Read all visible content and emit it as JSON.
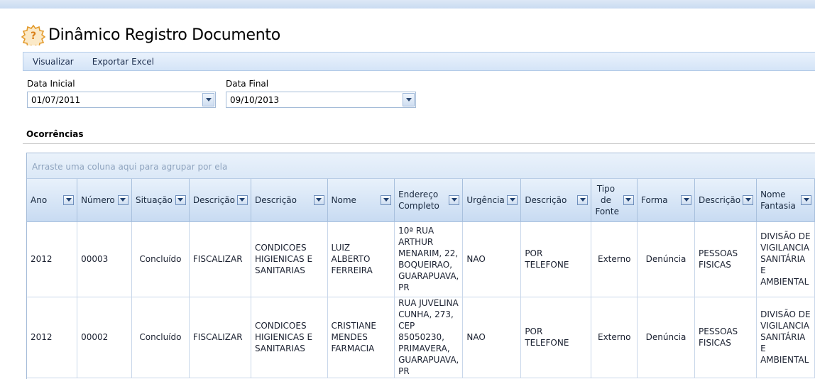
{
  "page": {
    "title": "Dinâmico Registro Documento"
  },
  "toolbar": {
    "items": [
      "Visualizar",
      "Exportar Excel"
    ]
  },
  "filters": {
    "start": {
      "label": "Data Inicial",
      "value": "01/07/2011"
    },
    "end": {
      "label": "Data Final",
      "value": "09/10/2013"
    }
  },
  "section": {
    "title": "Ocorrências"
  },
  "grid": {
    "group_hint": "Arraste uma coluna aqui para agrupar por ela",
    "columns": [
      "Ano",
      "Número",
      "Situação",
      "Descrição",
      "Descrição",
      "Nome",
      "Endereço Completo",
      "Urgência",
      "Descrição",
      "Tipo de Fonte",
      "Forma",
      "Descrição",
      "Nome Fantasia"
    ],
    "rows": [
      [
        "2012",
        "00003",
        "Concluído",
        "FISCALIZAR",
        "CONDICOES HIGIENICAS E SANITARIAS",
        "LUIZ ALBERTO FERREIRA",
        "10ª RUA ARTHUR MENARIM, 22, BOQUEIRAO, GUARAPUAVA, PR",
        "NAO",
        "POR TELEFONE",
        "Externo",
        "Denúncia",
        "PESSOAS FISICAS",
        "DIVISÃO DE VIGILANCIA SANITÁRIA E AMBIENTAL"
      ],
      [
        "2012",
        "00002",
        "Concluído",
        "FISCALIZAR",
        "CONDICOES HIGIENICAS E SANITARIAS",
        "CRISTIANE MENDES FARMACIA",
        "RUA JUVELINA CUNHA, 273, CEP 85050230, PRIMAVERA, GUARAPUAVA, PR",
        "NAO",
        "POR TELEFONE",
        "Externo",
        "Denúncia",
        "PESSOAS FISICAS",
        "DIVISÃO DE VIGILANCIA SANITÁRIA E AMBIENTAL"
      ]
    ]
  }
}
